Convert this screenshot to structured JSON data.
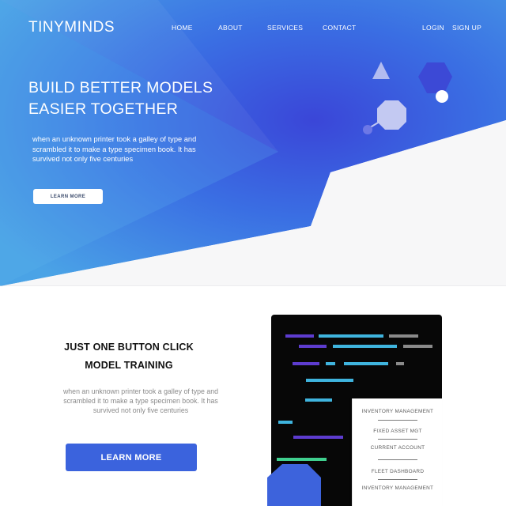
{
  "brand": {
    "name": "TINYMINDS"
  },
  "nav": {
    "items": [
      {
        "label": "HOME"
      },
      {
        "label": "ABOUT"
      },
      {
        "label": "SERVICES"
      },
      {
        "label": "CONTACT"
      }
    ],
    "login": "LOGIN",
    "signup": "SIGN UP"
  },
  "hero": {
    "title_line1": "BUILD BETTER MODELS",
    "title_line2": "EASIER TOGETHER",
    "text": "when an unknown printer took a galley of type and scrambled it to make a type specimen book. It has survived not only five centuries",
    "button": "LEARN MORE"
  },
  "feature": {
    "title_line1": "JUST ONE BUTTON CLICK",
    "title_line2": "MODEL TRAINING",
    "text": "when an unknown printer took a galley of type and scrambled it to make a type specimen book. It has survived not only five centuries",
    "button": "LEARN MORE"
  },
  "menu_card": {
    "items": [
      {
        "label": "INVENTORY MANAGEMENT"
      },
      {
        "label": "FIXED ASSET MGT"
      },
      {
        "label": "CURRENT ACCOUNT"
      },
      {
        "label": "FLEET DASHBOARD"
      },
      {
        "label": "INVENTORY MANAGEMENT"
      }
    ]
  },
  "colors": {
    "hero_gradient_start": "#4a9fe6",
    "hero_gradient_mid": "#3b5fe2",
    "hero_gradient_end": "#4a78e8",
    "primary_button": "#3b63dd",
    "code_bg": "#070707",
    "code_purple": "#5d3ccf",
    "code_cyan": "#3fb4de",
    "code_gray": "#8a8a8a",
    "code_green": "#3fcf8e"
  }
}
